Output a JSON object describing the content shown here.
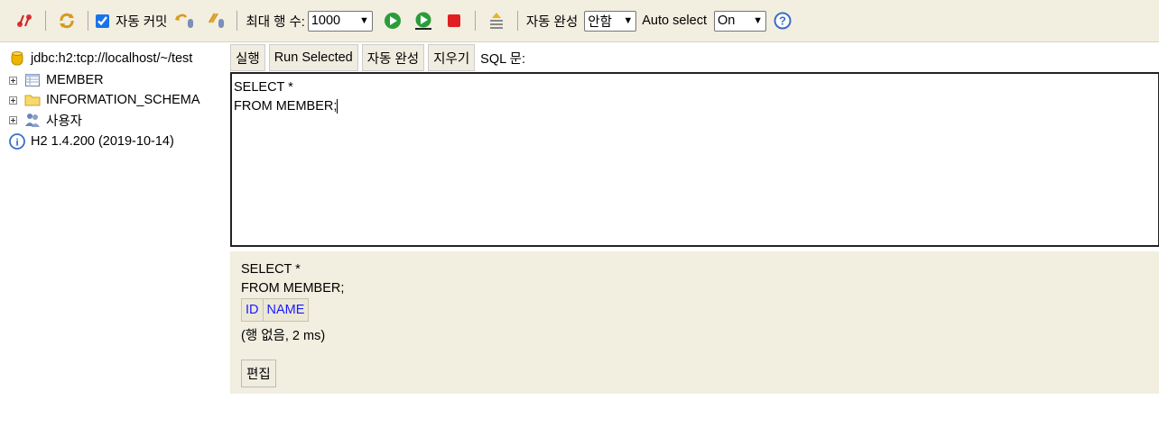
{
  "toolbar": {
    "auto_commit_label": "자동 커밋",
    "auto_commit_checked": true,
    "max_rows_label": "최대 행 수:",
    "max_rows_value": "1000",
    "autocomplete_label": "자동 완성",
    "autocomplete_value": "안함",
    "auto_select_label": "Auto select",
    "auto_select_value": "On",
    "icons": [
      "disconnect-icon",
      "refresh-icon",
      "commit-icon",
      "rollback-icon",
      "run-icon",
      "run-selected-icon",
      "stop-icon",
      "history-icon",
      "help-icon"
    ]
  },
  "tree": {
    "connection": "jdbc:h2:tcp://localhost/~/test",
    "items": [
      {
        "label": "MEMBER",
        "icon": "table-icon"
      },
      {
        "label": "INFORMATION_SCHEMA",
        "icon": "folder-icon"
      },
      {
        "label": "사용자",
        "icon": "users-icon"
      }
    ],
    "version": "H2 1.4.200 (2019-10-14)"
  },
  "sql_panel": {
    "buttons": {
      "run": "실행",
      "run_selected": "Run Selected",
      "autocomplete": "자동 완성",
      "clear": "지우기"
    },
    "sql_label": "SQL 문:",
    "editor_lines": [
      "SELECT *",
      "FROM MEMBER;"
    ]
  },
  "result": {
    "query_lines": [
      "SELECT *",
      "FROM MEMBER;"
    ],
    "columns": [
      "ID",
      "NAME"
    ],
    "status": "(행 없음, 2 ms)",
    "edit_button": "편집"
  },
  "colors": {
    "toolbar_bg": "#f2eee0",
    "column_link": "#1a1aff",
    "run_green": "#2a9d3a",
    "stop_red": "#e02020"
  }
}
